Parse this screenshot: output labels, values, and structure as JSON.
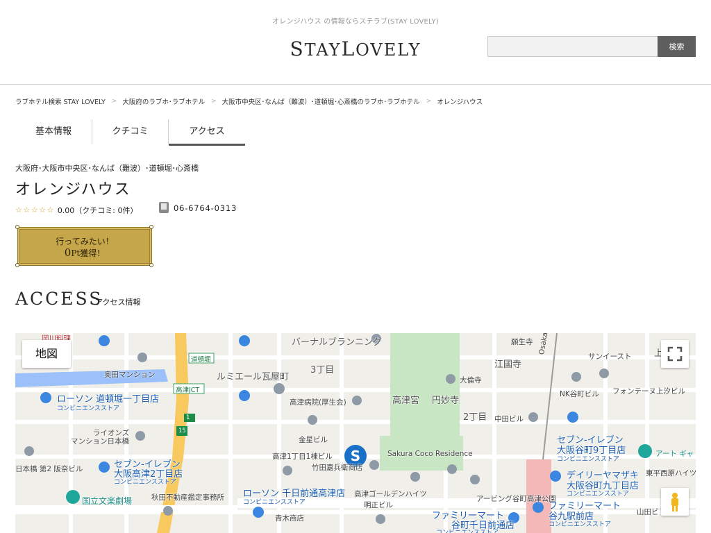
{
  "header": {
    "tagline": "オレンジハウス の情報ならステラブ(STAY LOVELY)",
    "logo_a": "S",
    "logo_b": "TAY",
    "logo_c": "L",
    "logo_d": "OVELY",
    "search": {
      "value": "",
      "button": "検索"
    }
  },
  "breadcrumb": [
    "ラブホテル検索 STAY LOVELY",
    "大阪府のラブホ･ラブホテル",
    "大阪市中央区･なんば（難波）･道頓堀･心斎橋のラブホ･ラブホテル",
    "オレンジハウス"
  ],
  "breadcrumb_sep": ">",
  "tabs": [
    "基本情報",
    "クチコミ",
    "アクセス"
  ],
  "hotel": {
    "area": "大阪府･大阪市中央区･なんば（難波）･道頓堀･心斎橋",
    "name": "オレンジハウス",
    "stars": "☆☆☆☆☆",
    "rating": "0.00（クチコミ: 0件）",
    "phone": "06-6764-0313"
  },
  "want_button": {
    "line1": "行ってみたい！",
    "points": "0",
    "unit": "Pt",
    "suffix": "獲得！"
  },
  "access": {
    "title": "ACCESS",
    "subtitle": "アクセス情報"
  },
  "map": {
    "type_button": "地図",
    "labels": {
      "okawa": "岡川料理",
      "burnal": "バーナルブランニング",
      "kanseiji": "願生寺",
      "osaka_izumi": "Osaka Izumi",
      "sunneast": "サンイースト",
      "ue": "上",
      "okuda": "奥田マンション",
      "dotonbori": "道頓堀",
      "lumiere": "ルミエール瓦屋町",
      "sanchome": "3丁目",
      "egoji": "江國寺",
      "daironji": "大倫寺",
      "nk": "NK谷町ビル",
      "fontaine": "フォンテーヌ上汐ビル",
      "kozu_jct": "高津JCT",
      "lawson1": "ローソン 道頓堀一丁目店",
      "lawson1_sub": "コンビニエンスストア",
      "kozu_hosp": "高津病院(厚生会)",
      "kozugu": "高津宮",
      "enmyoji": "円妙寺",
      "nichome": "2丁目",
      "nakata": "中田ビル",
      "seven1": "セブン-イレブン",
      "seven1b": "大阪谷町9丁目店",
      "seven1_sub": "コンビニエンスストア",
      "lions": "ライオンズ",
      "lions_b": "マンション日本橋",
      "kinsei": "金星ビル",
      "sakura": "Sakura Coco Residence",
      "art": "アート ギャ",
      "nihonbashi": "日本橋 第2 阪奈ビル",
      "seven2": "セブン-イレブン",
      "seven2b": "大阪高津2丁目店",
      "seven2_sub": "コンビニエンスストア",
      "kozu1": "高津1丁目1棟ビル",
      "takeda": "竹田嘉兵衛商店",
      "daily": "デイリーヤマザキ",
      "daily_b": "大阪谷町九丁目店",
      "daily_sub": "コンビニエンスストア",
      "higashi": "東平西原ハイツ",
      "bunraku": "国立文楽劇場",
      "akita": "秋田不動産鑑定事務所",
      "lawson2": "ローソン 千日前通高津店",
      "lawson2_sub": "コンビニエンスストア",
      "golden": "高津ゴールデンハイツ",
      "myoko": "明正ビル",
      "abing": "アービング谷町高津公園",
      "family": "ファミリーマート",
      "family_b": "谷九駅前店",
      "family_sub": "コンビニエンスストア",
      "family2": "ファミリーマート",
      "family2b": "谷町千日前通店",
      "family2_sub": "コンビニエンスストア",
      "aoki": "青木商店",
      "yamada": "山田ビ",
      "route1": "1",
      "route15": "15"
    }
  }
}
